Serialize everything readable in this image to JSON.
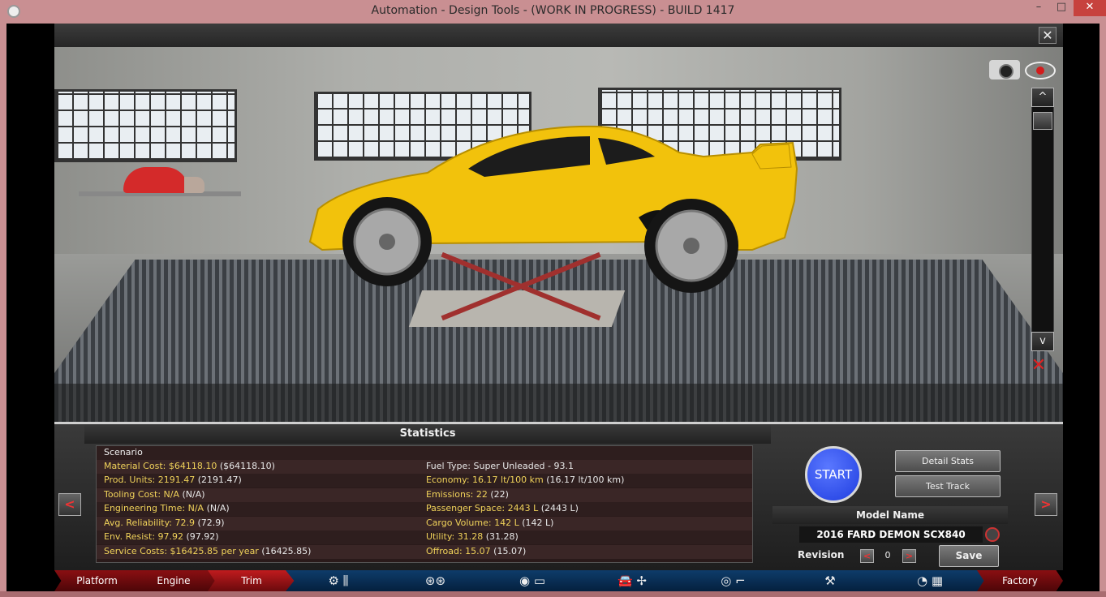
{
  "window": {
    "title": "Automation - Design Tools - (WORK IN PROGRESS) - BUILD 1417",
    "minimize_glyph": "–",
    "maximize_glyph": "□",
    "close_glyph": "✕"
  },
  "viewport": {
    "close_glyph": "✕",
    "scroll_up_glyph": "^",
    "scroll_down_glyph": "v"
  },
  "statistics": {
    "header": "Statistics",
    "scenario": "Scenario",
    "left": [
      {
        "key": "Material Cost: $64118.10",
        "val": "($64118.10)"
      },
      {
        "key": "Prod. Units: 2191.47",
        "val": "(2191.47)"
      },
      {
        "key": "Tooling Cost: N/A",
        "val": "(N/A)"
      },
      {
        "key": "Engineering Time: N/A",
        "val": "(N/A)"
      },
      {
        "key": "Avg. Reliability: 72.9",
        "val": "(72.9)"
      },
      {
        "key": "Env. Resist: 97.92",
        "val": "(97.92)"
      },
      {
        "key": "Service Costs: $16425.85 per year",
        "val": "(16425.85)"
      }
    ],
    "right": [
      {
        "key": "",
        "val": "Fuel Type: Super Unleaded - 93.1"
      },
      {
        "key": "Economy: 16.17 lt/100 km",
        "val": "(16.17 lt/100 km)"
      },
      {
        "key": "Emissions: 22",
        "val": "(22)"
      },
      {
        "key": "Passenger Space: 2443 L",
        "val": "(2443 L)"
      },
      {
        "key": "Cargo Volume: 142 L",
        "val": "(142 L)"
      },
      {
        "key": "Utility: 31.28",
        "val": "(31.28)"
      },
      {
        "key": "Offroad: 15.07",
        "val": "(15.07)"
      }
    ]
  },
  "controls": {
    "prev_glyph": "<",
    "next_glyph": ">",
    "start_label": "START",
    "detail_stats_label": "Detail Stats",
    "test_track_label": "Test Track",
    "model_name_label": "Model Name",
    "model_name_value": "2016 FARD DEMON SCX840",
    "revision_label": "Revision",
    "revision_value": "0",
    "rev_minus_glyph": "<",
    "rev_plus_glyph": ">",
    "save_label": "Save"
  },
  "bottom_nav": {
    "platform": "Platform",
    "engine": "Engine",
    "trim": "Trim",
    "factory": "Factory",
    "icons": [
      "engine-parts-icon",
      "wheels-icon",
      "body-icon",
      "car-fan-icon",
      "interior-icon",
      "suspension-icon",
      "test-finish-icon"
    ]
  },
  "colors": {
    "title_bar": "#c98f92",
    "stat_key": "#f0d25a",
    "start_button": "#1f3de0",
    "nav_red": "#8a0f12",
    "nav_blue": "#0e3c6a",
    "car_body": "#f2c20c"
  }
}
